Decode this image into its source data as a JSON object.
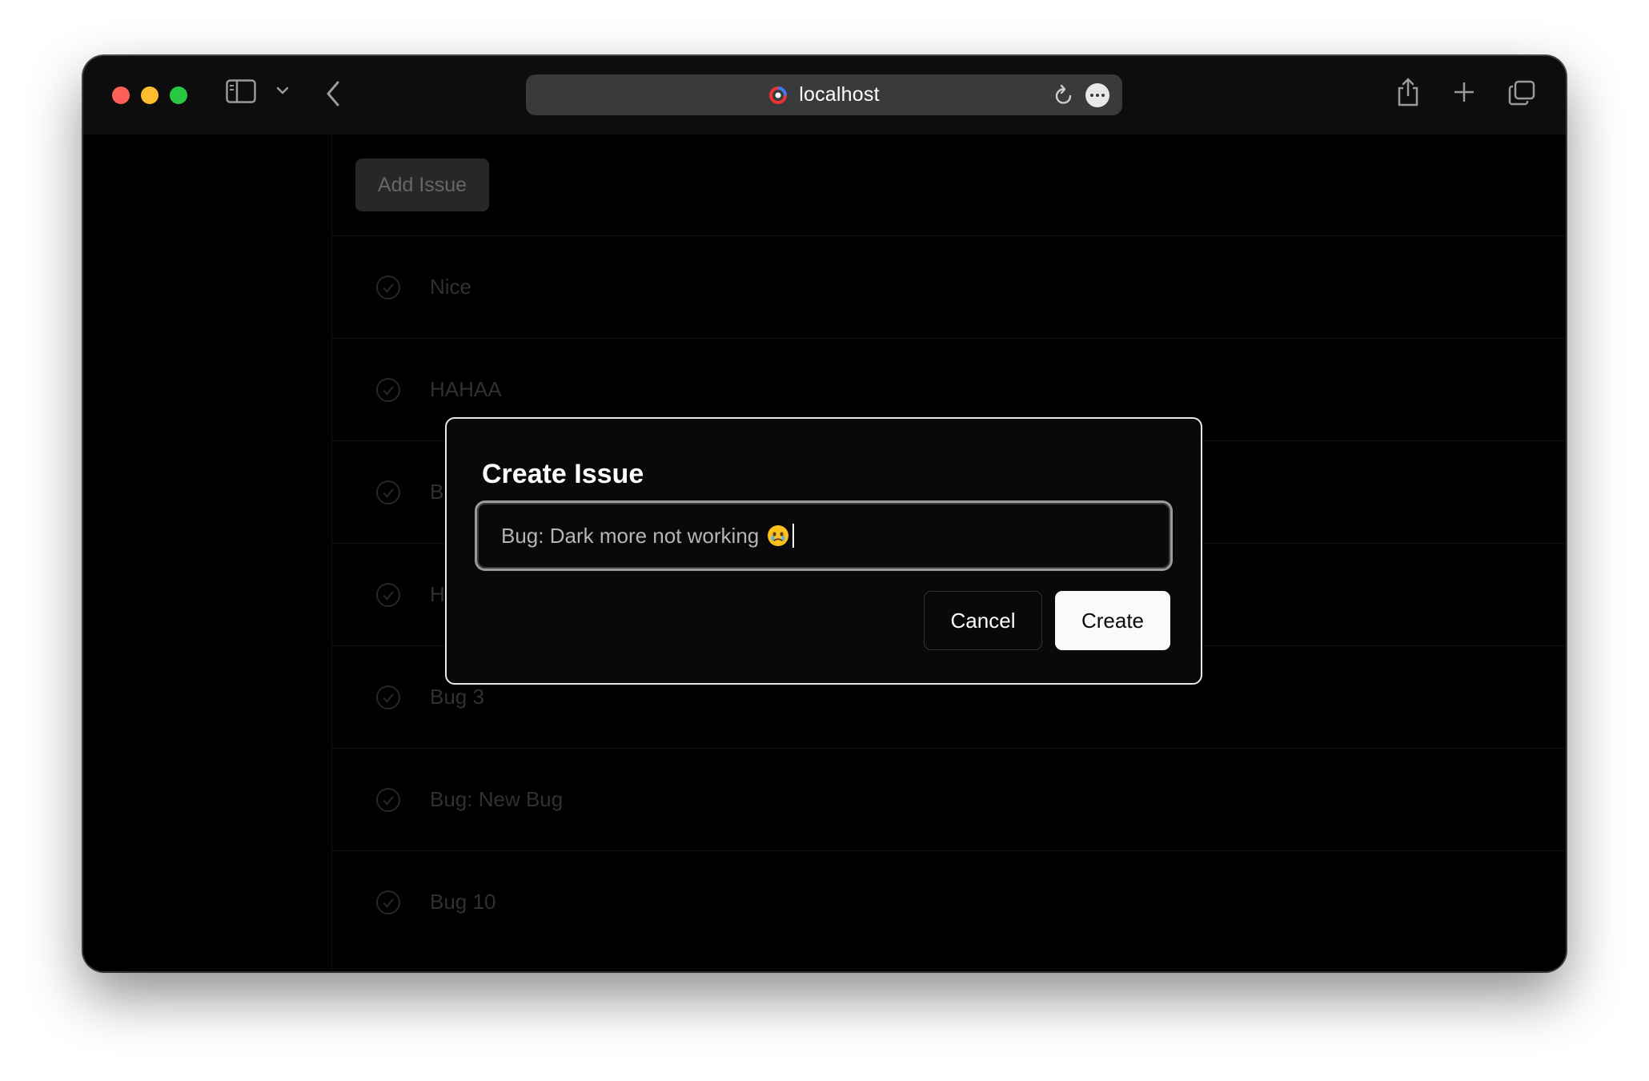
{
  "browser": {
    "url": "localhost",
    "icons": [
      "sidebar-icon",
      "chevron-down-icon",
      "back-icon",
      "reload-icon",
      "more-icon",
      "share-icon",
      "new-tab-icon",
      "tabs-overview-icon"
    ]
  },
  "page": {
    "add_issue_label": "Add Issue",
    "issues": [
      {
        "title": "Nice"
      },
      {
        "title": "HAHAA"
      },
      {
        "title": "B"
      },
      {
        "title": "H"
      },
      {
        "title": "Bug 3"
      },
      {
        "title": "Bug: New Bug"
      },
      {
        "title": "Bug 10"
      }
    ]
  },
  "dialog": {
    "title": "Create Issue",
    "input_value": "Bug: Dark more not working",
    "input_emoji": "face-holding-back-tears-icon",
    "cancel_label": "Cancel",
    "create_label": "Create"
  },
  "colors": {
    "traffic_red": "#fe5f57",
    "traffic_yellow": "#febc2e",
    "traffic_green": "#28c840",
    "dialog_bg": "#09090b",
    "primary_button": "#fafafa"
  }
}
